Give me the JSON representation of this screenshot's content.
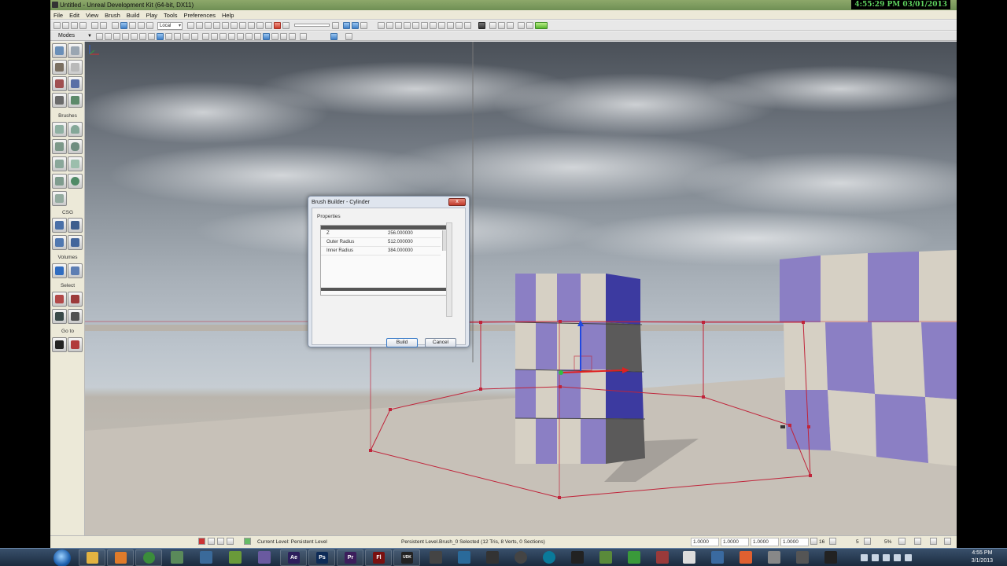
{
  "window": {
    "title": "Untitled - Unreal Development Kit (64-bit, DX11)",
    "clock_overlay": "4:55:29 PM 03/01/2013"
  },
  "menu": [
    "File",
    "Edit",
    "View",
    "Brush",
    "Build",
    "Play",
    "Tools",
    "Preferences",
    "Help"
  ],
  "toolbar": {
    "coord_system": "Local",
    "modes_label": "Modes"
  },
  "modes_panel": {
    "sections": {
      "brushes": "Brushes",
      "csg": "CSG",
      "volumes": "Volumes",
      "select": "Select",
      "goto": "Go to"
    }
  },
  "brush_builder": {
    "title": "Brush Builder - Cylinder",
    "group": "Properties",
    "properties": [
      {
        "name": "Z",
        "value": "256.000000"
      },
      {
        "name": "Outer Radius",
        "value": "512.000000"
      },
      {
        "name": "Inner Radius",
        "value": "384.000000"
      }
    ],
    "build_label": "Build",
    "cancel_label": "Cancel",
    "close_label": "x"
  },
  "statusbar": {
    "current_level": "Current Level:  Persistent Level",
    "selection": "Persistent Level.Brush_0 Selected (12 Tris, 8 Verts, 0 Sections)",
    "drag_x": "1.0000",
    "drag_y": "1.0000",
    "drag_z": "1.0000",
    "scale": "1.0000",
    "grid": "16",
    "rotation": "5",
    "scale_pct": "5%"
  },
  "taskbar": {
    "time": "4:55 PM",
    "date": "3/1/2013",
    "apps": [
      {
        "name": "explorer-icon",
        "label": "",
        "color": "#e3b341"
      },
      {
        "name": "media-player-icon",
        "label": "",
        "color": "#e07b2a"
      },
      {
        "name": "chrome-icon",
        "label": "",
        "color": "#3b8d3b"
      },
      {
        "name": "after-effects-icon",
        "label": "Ae",
        "color": "#2d1e5c"
      },
      {
        "name": "photoshop-icon",
        "label": "Ps",
        "color": "#0d2b57"
      },
      {
        "name": "premiere-icon",
        "label": "Pr",
        "color": "#3c1e5c"
      },
      {
        "name": "flash-icon",
        "label": "Fl",
        "color": "#7a1010"
      },
      {
        "name": "udk-icon",
        "label": "UDK",
        "color": "#222222"
      }
    ]
  },
  "colors": {
    "cube_purple": "#8b7fc4",
    "cube_cream": "#d6d0c4",
    "brush_red": "#c0243a",
    "sky_top": "#4a5058",
    "floor": "#c9c4bc"
  }
}
